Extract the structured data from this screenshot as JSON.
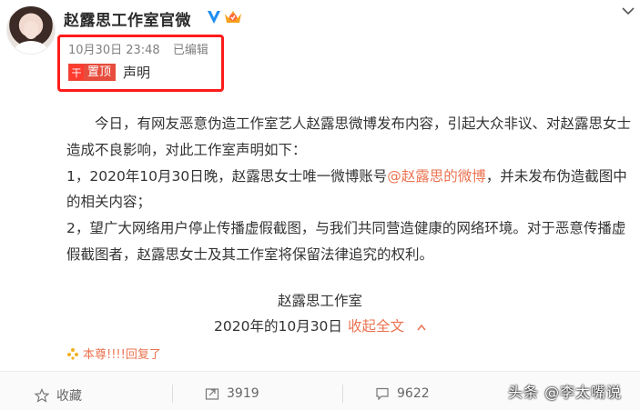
{
  "post": {
    "author": "赵露思工作室官微",
    "timestamp": "10月30日 23:48",
    "edited_label": "已编辑",
    "pin_icon_glyph": "干",
    "pin_label": "置顶",
    "pin_title": "声明",
    "paragraphs": {
      "p1": "今日，有网友恶意伪造工作室艺人赵露思微博发布内容，引起大众非议、对赵露思女士造成不良影响，对此工作室声明如下：",
      "p2_prefix": "1，2020年10月30日晚，赵露思女士唯一微博账号",
      "p2_mention": "@赵露思的微博",
      "p2_suffix": "，并未发布伪造截图中的相关内容；",
      "p3": "2，望广大网络用户停止传播虚假截图，与我们共同营造健康的网络环境。对于恶意传播虚假截图者，赵露思女士及其工作室将保留法律追究的权利。"
    },
    "signature": "赵露思工作室",
    "date": "2020年的10月30日",
    "collapse_label": "收起全文",
    "reply_note": "本尊!!!!回复了"
  },
  "actions": {
    "favorite_label": "收藏",
    "repost_count": "3919",
    "comment_count": "9622"
  },
  "watermark": "头条 @李太嘴说",
  "colors": {
    "accent": "#eb7350",
    "pin_red": "#e74c3c",
    "highlight_box": "#ff1b1b",
    "verified_blue": "#1d8df2"
  },
  "icons": [
    "verified-badge-icon",
    "crown-badge-icon",
    "chevron-down-icon",
    "pin-icon",
    "chevron-up-icon",
    "sparkle-icon",
    "star-icon",
    "repost-icon",
    "comment-icon"
  ]
}
